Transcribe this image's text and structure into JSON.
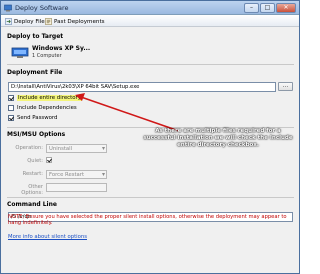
{
  "window": {
    "title": "Deploy Software"
  },
  "toolbar": {
    "deploy_file": "Deploy File",
    "past_deployments": "Past Deployments"
  },
  "deploy_target": {
    "heading": "Deploy to Target",
    "name": "Windows XP Sy...",
    "count": "1 Computer"
  },
  "deployment_file": {
    "heading": "Deployment File",
    "path": "D:\\Install\\AntiVirus\\2k03\\XP 64bit SAV\\Setup.exe",
    "browse_label": "...",
    "include_entire_directory": {
      "label": "Include entire directory",
      "checked": true
    },
    "include_dependencies": {
      "label": "Include Dependencies",
      "checked": false
    },
    "send_password": {
      "label": "Send Password",
      "checked": true
    }
  },
  "msi_options": {
    "heading": "MSI/MSU Options",
    "operation": {
      "label": "Operation:",
      "value": "Uninstall"
    },
    "quiet": {
      "label": "Quiet:",
      "checked": true
    },
    "restart": {
      "label": "Restart:",
      "value": "Force Restart"
    },
    "other_options": {
      "label": "Other Options:",
      "value": ""
    }
  },
  "command_line": {
    "heading": "Command Line",
    "value": "/S /v/qn"
  },
  "note": "NOTE: Ensure you have selected the proper silent install options, otherwise the deployment may appear to hang indefinitely.",
  "link": "More info about silent options",
  "callout": "As there are multiple files required for a successful installation we will check the Include entire directory checkbox.",
  "colors": {
    "note_red": "#c00000",
    "link_blue": "#1a4fc4",
    "highlight": "#f4f57a",
    "arrow": "#d01818"
  }
}
